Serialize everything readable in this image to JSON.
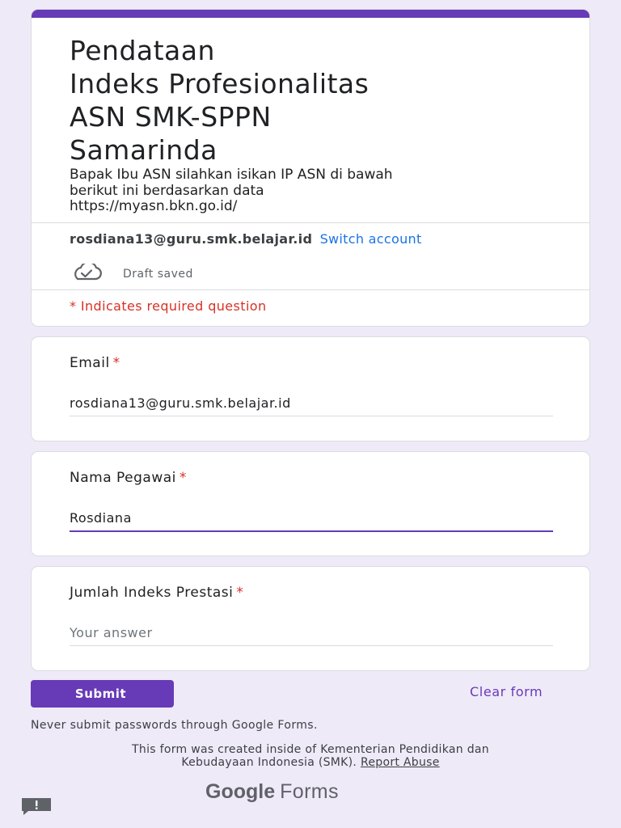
{
  "header": {
    "title": "Pendataan\nIndeks Profesionalitas\nASN SMK-SPPN\nSamarinda",
    "description": "Bapak Ibu ASN silahkan isikan IP ASN di bawah\nberikut ini berdasarkan data\nhttps://myasn.bkn.go.id/",
    "account_email": "rosdiana13@guru.smk.belajar.id",
    "switch_account": "Switch account",
    "draft_status": "Draft saved",
    "required_note": "* Indicates required question"
  },
  "questions": [
    {
      "label": "Email",
      "required_mark": "*",
      "value": "rosdiana13@guru.smk.belajar.id",
      "placeholder": ""
    },
    {
      "label": "Nama Pegawai",
      "required_mark": "*",
      "value": "Rosdiana",
      "placeholder": ""
    },
    {
      "label": "Jumlah Indeks Prestasi",
      "required_mark": "*",
      "value": "",
      "placeholder": "Your answer"
    }
  ],
  "actions": {
    "submit": "Submit",
    "clear": "Clear form"
  },
  "footer": {
    "never_submit": "Never submit passwords through Google Forms.",
    "created_line1": "This form was created inside of Kementerian Pendidikan dan",
    "created_line2": "Kebudayaan Indonesia (SMK).",
    "report_abuse": "Report Abuse",
    "brand_google": "Google",
    "brand_forms": "Forms"
  },
  "colors": {
    "accent": "#673ab7",
    "background": "#efeaf8",
    "required": "#d93025",
    "link": "#1a73e8"
  },
  "icons": {
    "draft": "cloud-check-icon",
    "feedback": "feedback-icon"
  }
}
